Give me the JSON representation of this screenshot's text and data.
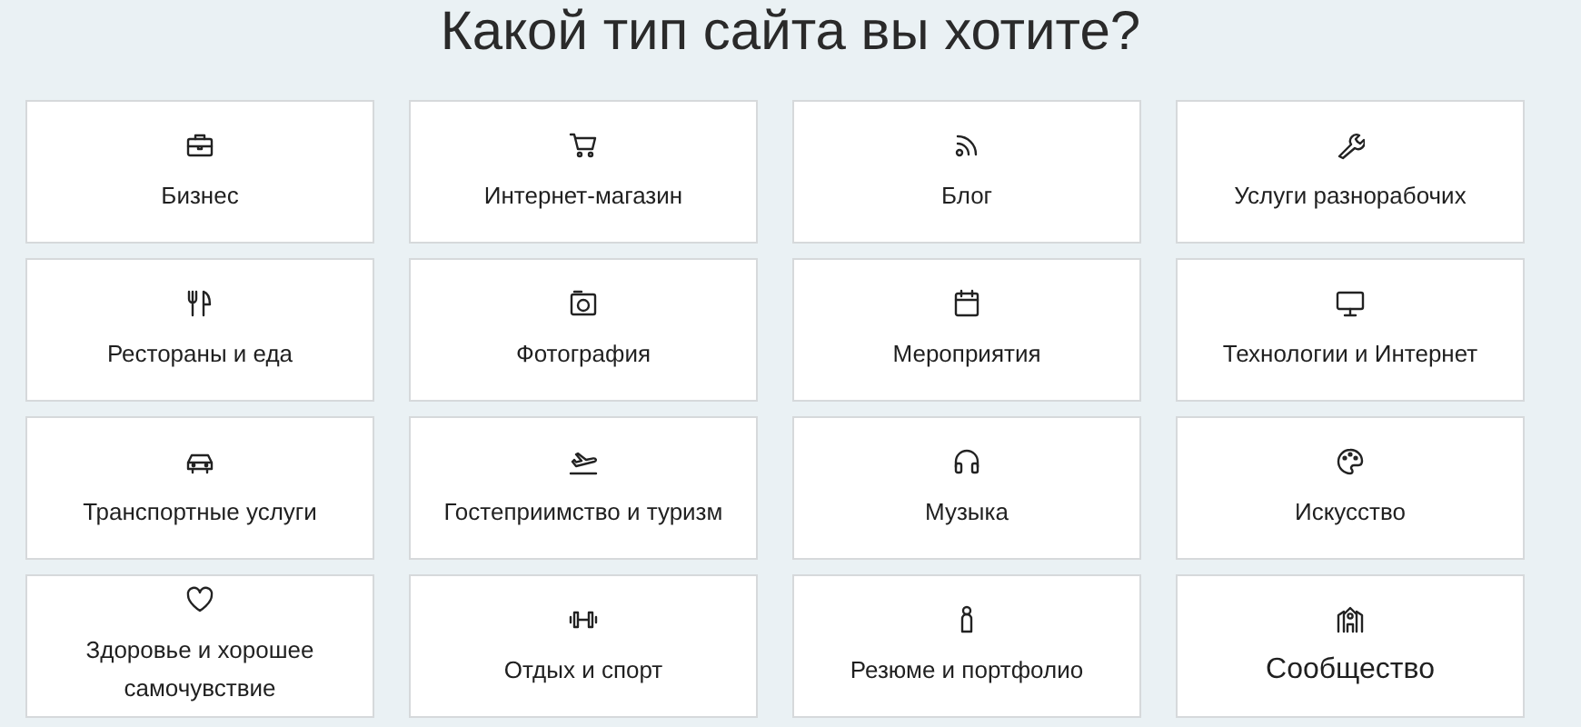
{
  "title": "Какой тип сайта вы хотите?",
  "cards": [
    {
      "label": "Бизнес"
    },
    {
      "label": "Интернет-магазин"
    },
    {
      "label": "Блог"
    },
    {
      "label": "Услуги разнорабочих"
    },
    {
      "label": "Рестораны и еда"
    },
    {
      "label": "Фотография"
    },
    {
      "label": "Мероприятия"
    },
    {
      "label": "Технологии и Интернет"
    },
    {
      "label": "Транспортные услуги"
    },
    {
      "label": "Гостеприимство и туризм"
    },
    {
      "label": "Музыка"
    },
    {
      "label": "Искусство"
    },
    {
      "label": "Здоровье и хорошее самочувствие"
    },
    {
      "label": "Отдых и спорт"
    },
    {
      "label": "Резюме и портфолио"
    },
    {
      "label": "Сообщество"
    }
  ]
}
